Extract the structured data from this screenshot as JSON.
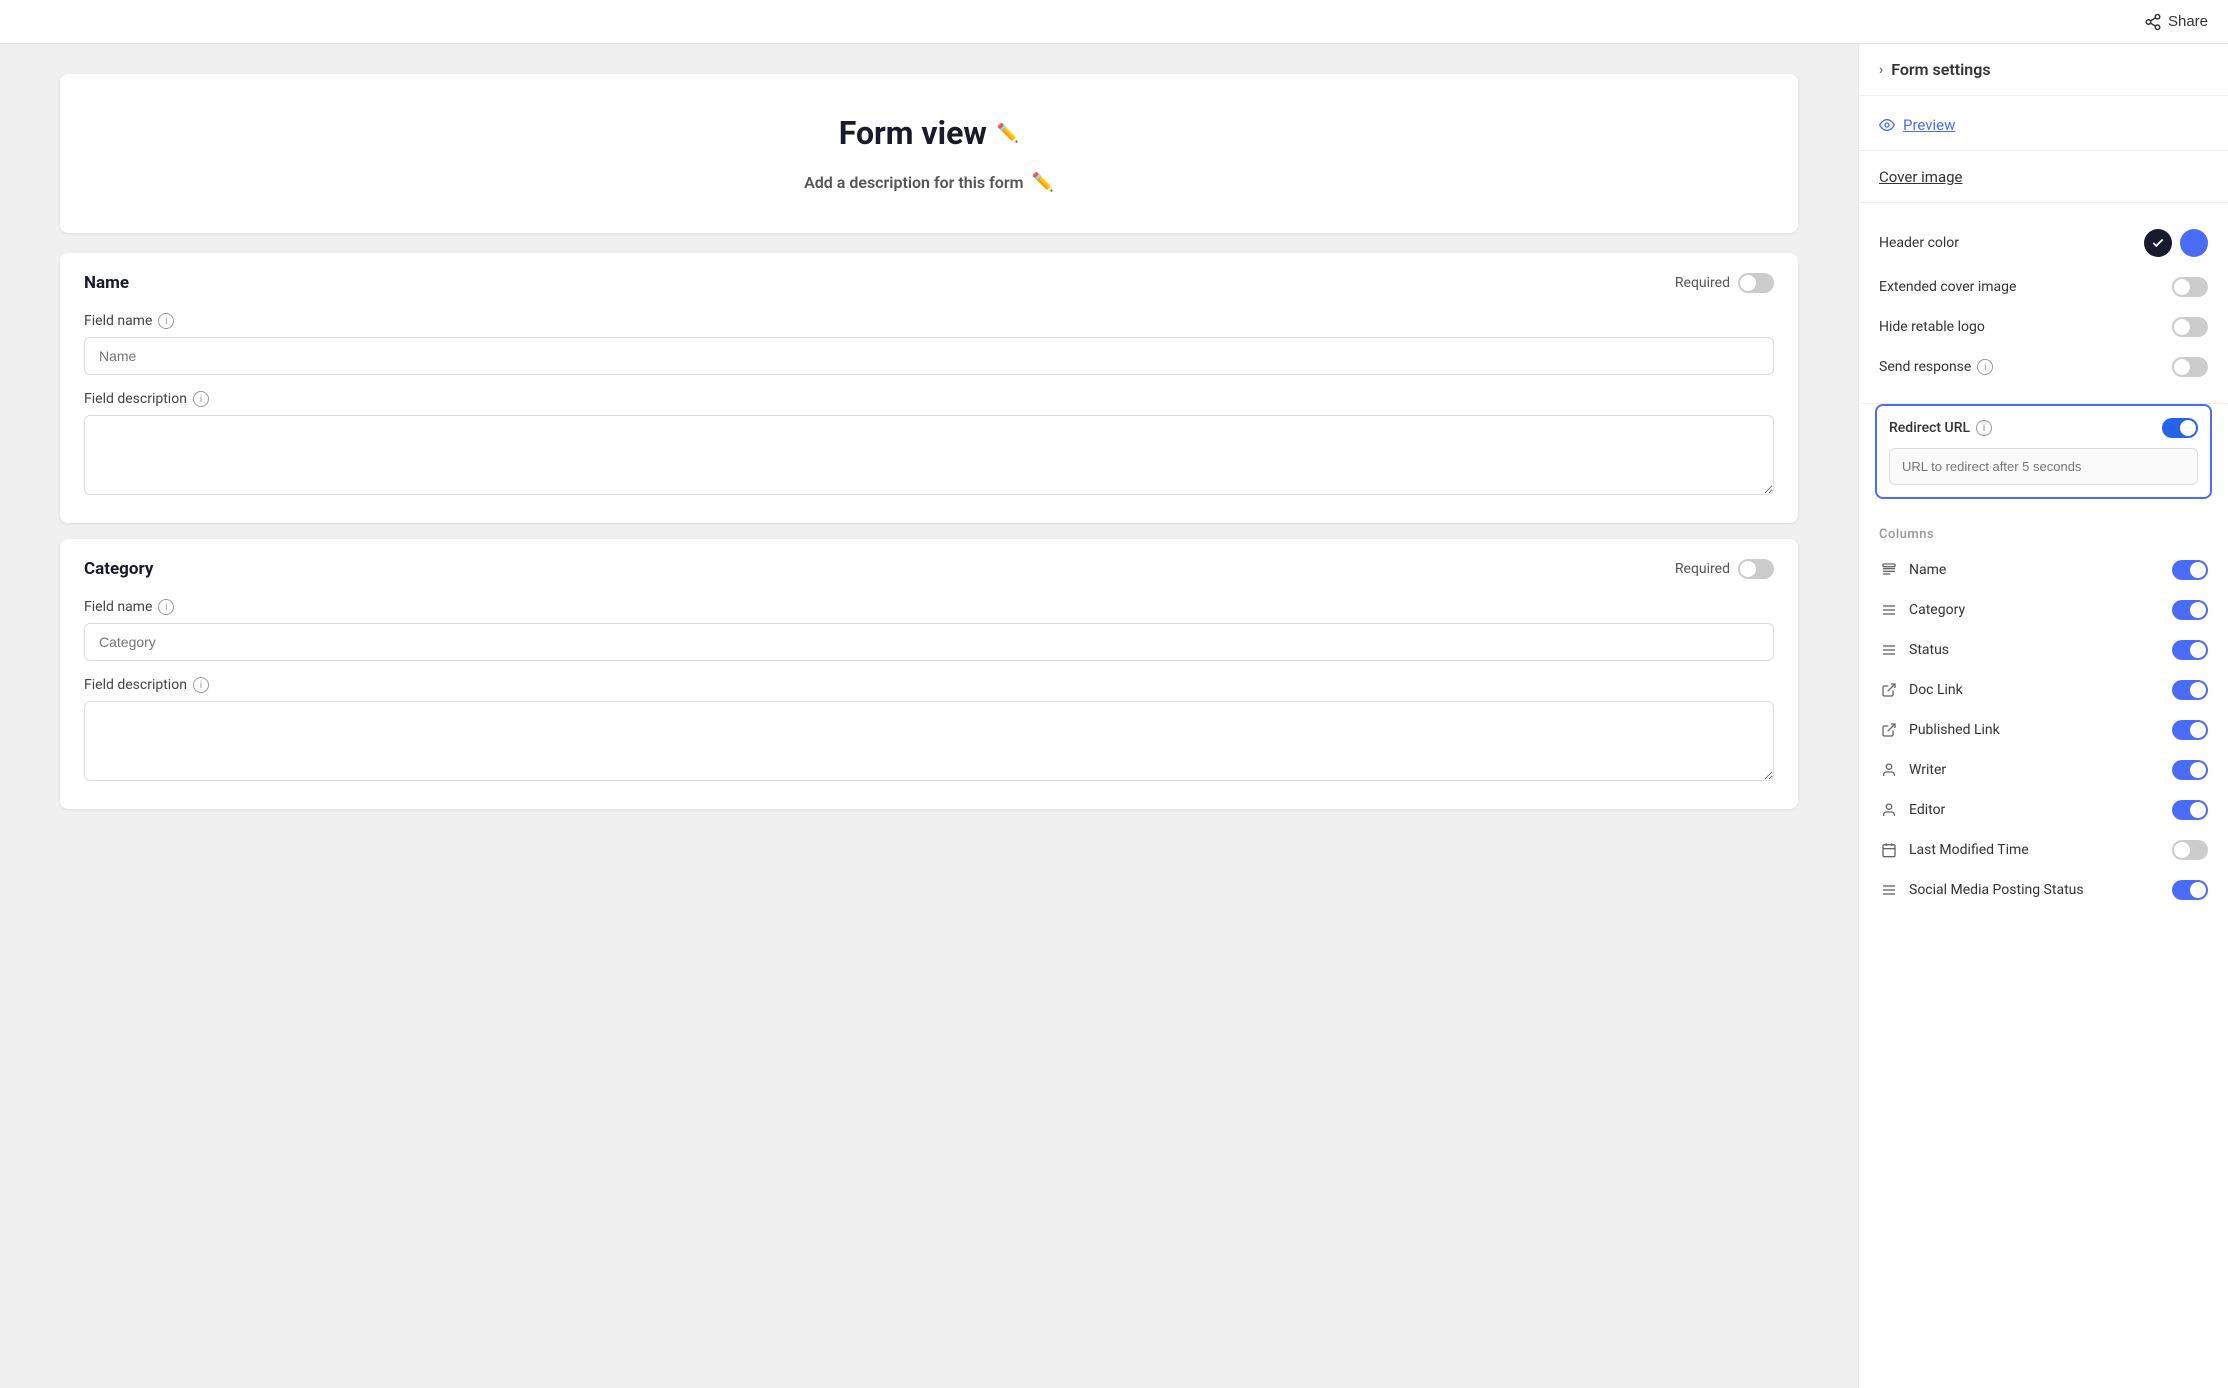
{
  "topbar": {
    "share_label": "Share"
  },
  "form": {
    "title": "Form view",
    "description_placeholder": "Add a description for this form",
    "fields": [
      {
        "name": "Name",
        "required_label": "Required",
        "field_name_label": "Field name",
        "field_name_placeholder": "Name",
        "field_description_label": "Field description",
        "field_description_placeholder": ""
      },
      {
        "name": "Category",
        "required_label": "Required",
        "field_name_label": "Field name",
        "field_name_placeholder": "Category",
        "field_description_label": "Field description",
        "field_description_placeholder": ""
      }
    ]
  },
  "sidebar": {
    "form_settings_label": "Form settings",
    "preview_label": "Preview",
    "cover_image_label": "Cover image",
    "header_color_label": "Header color",
    "extended_cover_image_label": "Extended cover image",
    "hide_retable_logo_label": "Hide retable logo",
    "send_response_label": "Send response",
    "redirect_url_label": "Redirect URL",
    "redirect_url_placeholder": "URL to redirect after 5 seconds",
    "columns_header": "Columns",
    "columns": [
      {
        "name": "Name",
        "icon": "text",
        "enabled": true
      },
      {
        "name": "Category",
        "icon": "menu",
        "enabled": true
      },
      {
        "name": "Status",
        "icon": "menu",
        "enabled": true
      },
      {
        "name": "Doc Link",
        "icon": "external",
        "enabled": true
      },
      {
        "name": "Published Link",
        "icon": "external",
        "enabled": true
      },
      {
        "name": "Writer",
        "icon": "user",
        "enabled": true
      },
      {
        "name": "Editor",
        "icon": "user",
        "enabled": true
      },
      {
        "name": "Last Modified Time",
        "icon": "calendar",
        "enabled": false
      },
      {
        "name": "Social Media Posting Status",
        "icon": "menu",
        "enabled": true
      }
    ]
  }
}
